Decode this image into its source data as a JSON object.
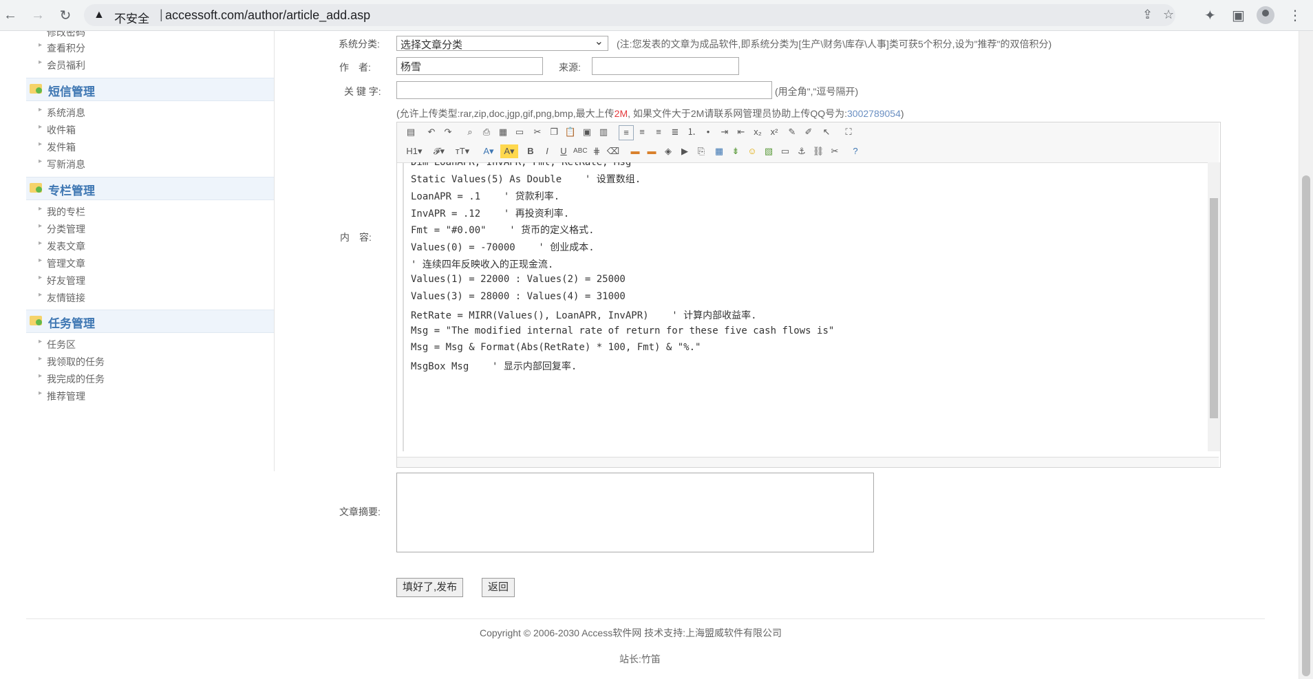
{
  "browser": {
    "security_label": "不安全",
    "url": "accessoft.com/author/article_add.asp"
  },
  "sidebar": {
    "account_links": [
      "修改密码",
      "查看积分",
      "会员福利"
    ],
    "sections": [
      {
        "title": "短信管理",
        "items": [
          "系统消息",
          "收件箱",
          "发件箱",
          "写新消息"
        ]
      },
      {
        "title": "专栏管理",
        "items": [
          "我的专栏",
          "分类管理",
          "发表文章",
          "管理文章",
          "好友管理",
          "友情链接"
        ]
      },
      {
        "title": "任务管理",
        "items": [
          "任务区",
          "我领取的任务",
          "我完成的任务",
          "推荐管理"
        ]
      }
    ]
  },
  "form": {
    "category_label": "系统分类:",
    "category_value": "选择文章分类",
    "category_note_prefix": "(注:",
    "category_note": "您发表的文章为成品软件,即系统分类为[生产\\财务\\库存\\人事]类可获5个积分,设为\"推荐\"的双倍积分)",
    "author_label": "作　者:",
    "author_value": "杨雪",
    "source_label": "来源:",
    "source_value": "",
    "keywords_label": "关 键 字:",
    "keywords_value": "",
    "keywords_note": "(用全角\",\"逗号隔开)",
    "upload_note_1": "(允许上传类型:rar,zip,doc,jgp,gif,png,bmp,最大上传",
    "upload_note_size": "2M",
    "upload_note_2": ", 如果文件大于2M请联系网管理员协助上传QQ号为:",
    "upload_qq": "3002789054",
    "upload_note_end": ")",
    "content_label": "内　容:",
    "summary_label": "文章摘要:",
    "summary_value": "",
    "submit_label": "填好了,发布",
    "back_label": "返回"
  },
  "editor": {
    "code_lines": [
      "Dim LoanAPR, InvAPR, Fmt, RetRate, Msg",
      "Static Values(5) As Double    ' 设置数组.",
      "LoanAPR = .1    ' 贷款利率.",
      "InvAPR = .12    ' 再投资利率.",
      "Fmt = \"#0.00\"    ' 货币的定义格式.",
      "Values(0) = -70000    ' 创业成本.",
      "' 连续四年反映收入的正现金流.",
      "Values(1) = 22000 : Values(2) = 25000",
      "Values(3) = 28000 : Values(4) = 31000",
      "RetRate = MIRR(Values(), LoanAPR, InvAPR)    ' 计算内部收益率.",
      "Msg = \"The modified internal rate of return for these five cash flows is\"",
      "Msg = Msg & Format(Abs(RetRate) * 100, Fmt) & \"%.\"",
      "MsgBox Msg    ' 显示内部回复率."
    ]
  },
  "footer": {
    "copyright": "Copyright © 2006-2030 Access软件网 技术支持:上海盟威软件有限公司",
    "webmaster": "站长:竹笛"
  },
  "colors": {
    "accent": "#3f77b3",
    "note_red": "#e4393c",
    "qq_blue": "#6a8fc2"
  }
}
